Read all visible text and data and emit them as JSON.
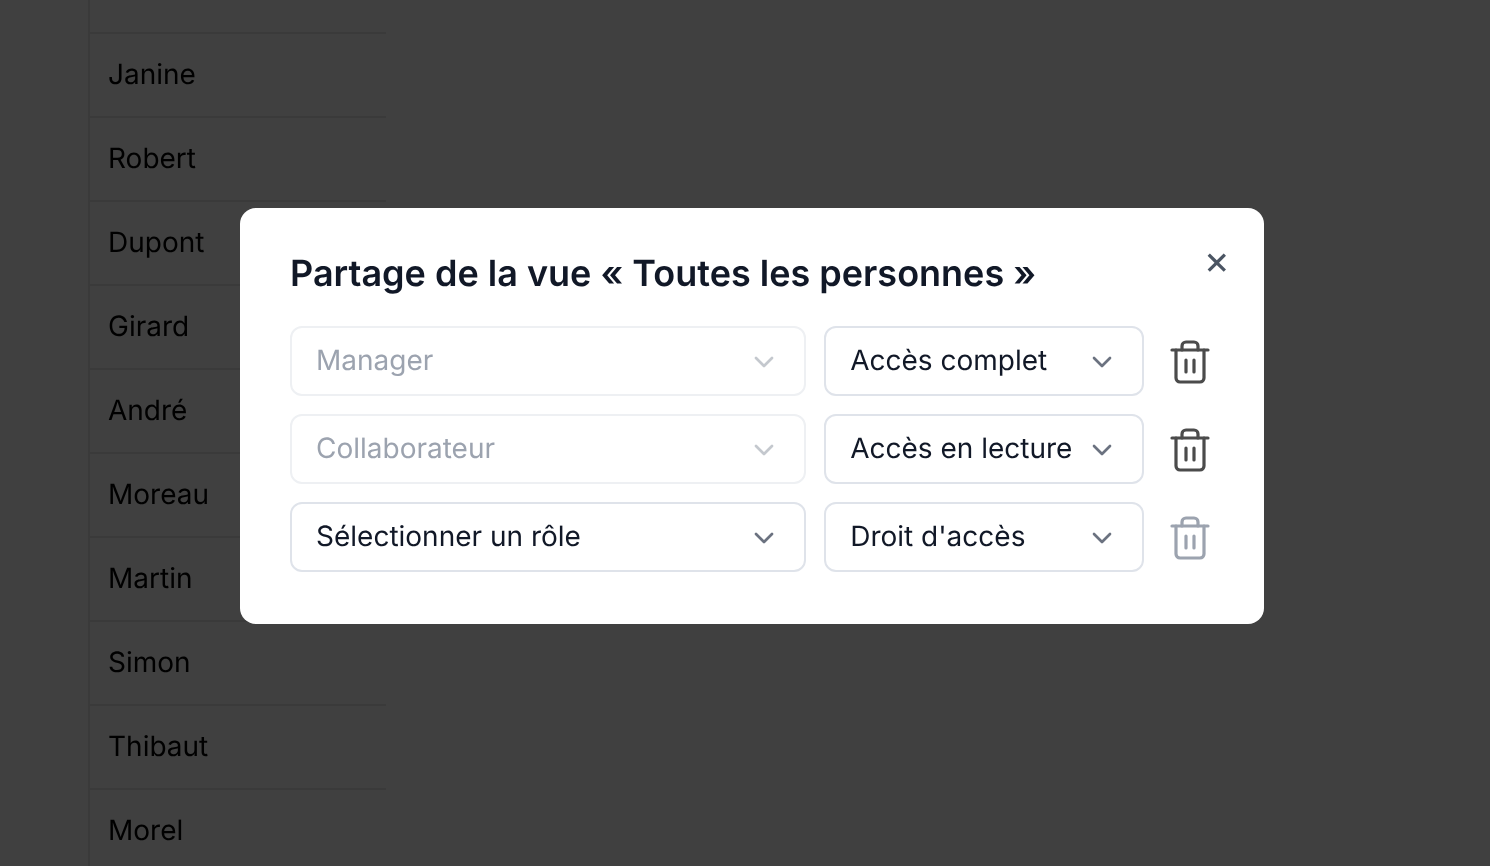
{
  "background_list": {
    "rows": [
      "Janine",
      "Robert",
      "Dupont",
      "Girard",
      "André",
      "Moreau",
      "Martin",
      "Simon",
      "Thibaut",
      "Morel"
    ]
  },
  "dialog": {
    "title": "Partage de la vue « Toutes les personnes »",
    "close": "×",
    "rows": [
      {
        "role": "Manager",
        "role_disabled": true,
        "access": "Accès complet",
        "delete_disabled": false
      },
      {
        "role": "Collaborateur",
        "role_disabled": true,
        "access": "Accès en lecture",
        "delete_disabled": false
      },
      {
        "role": "Sélectionner un rôle",
        "role_disabled": false,
        "access": "Droit d'accès",
        "delete_disabled": true
      }
    ]
  }
}
